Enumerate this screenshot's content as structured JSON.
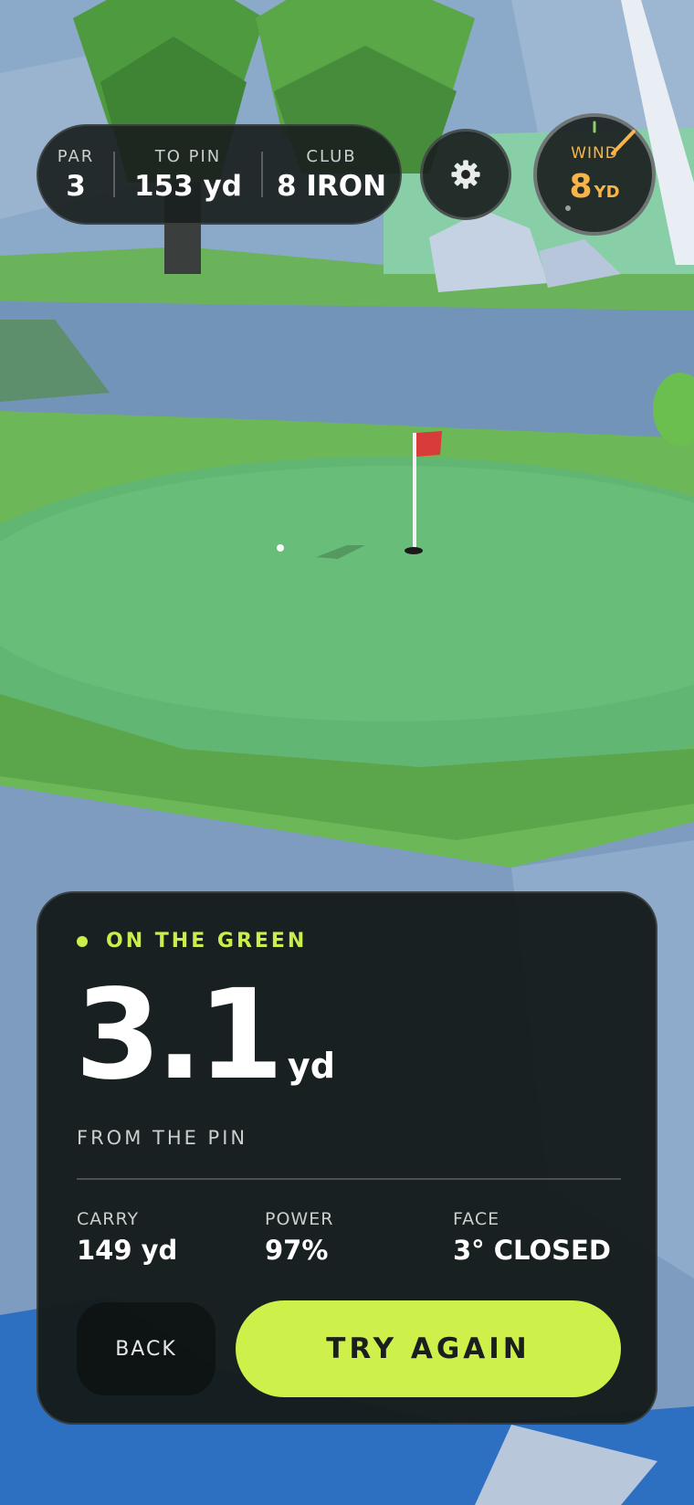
{
  "hud": {
    "par": {
      "label": "PAR",
      "value": "3"
    },
    "to_pin": {
      "label": "TO PIN",
      "value": "153 yd"
    },
    "club": {
      "label": "CLUB",
      "value": "8 IRON"
    },
    "settings_icon": "gear-icon",
    "wind": {
      "label": "WIND",
      "value": "8",
      "unit": "YD"
    }
  },
  "result": {
    "status": "ON THE GREEN",
    "distance": "3.1",
    "distance_unit": "yd",
    "distance_caption": "FROM THE PIN",
    "metrics": [
      {
        "label": "CARRY",
        "value": "149 yd"
      },
      {
        "label": "POWER",
        "value": "97%"
      },
      {
        "label": "FACE",
        "value": "3° CLOSED"
      }
    ],
    "back_label": "BACK",
    "retry_label": "TRY AGAIN"
  },
  "colors": {
    "accent": "#cdf04a",
    "wind": "#f6b44a",
    "flag": "#d93a3a",
    "panel": "#141918"
  }
}
